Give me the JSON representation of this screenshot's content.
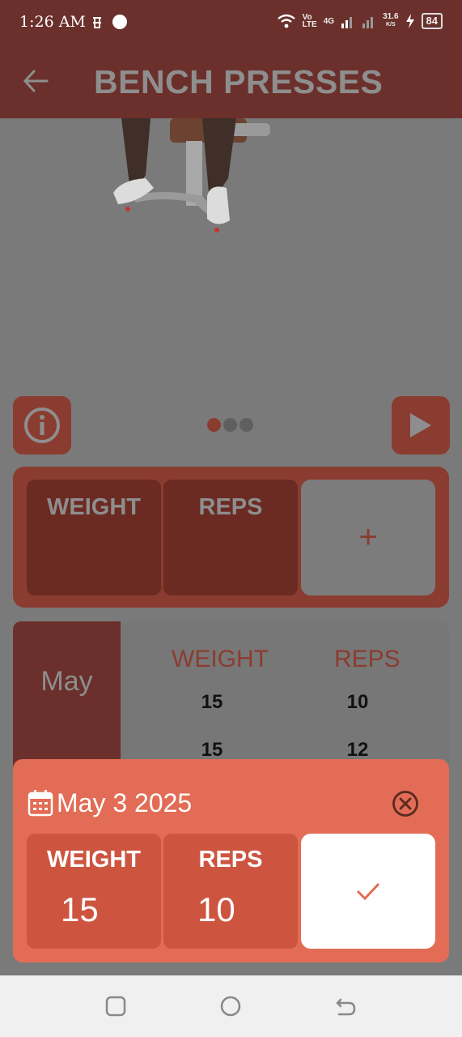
{
  "status_bar": {
    "time": "1:26 AM",
    "network_label": "4G",
    "volte_label": "Vo\nLTE",
    "speed_value": "31.6",
    "speed_unit": "K/S",
    "battery": "84"
  },
  "app_bar": {
    "title": "BENCH PRESSES",
    "back_icon": "arrow-left-icon"
  },
  "controls": {
    "info_icon": "info-icon",
    "play_icon": "play-icon",
    "page_dots": 3,
    "active_dot": 0
  },
  "input_card": {
    "weight_label": "WEIGHT",
    "reps_label": "REPS",
    "add_symbol": "+"
  },
  "history": {
    "month": "May",
    "weight_header": "WEIGHT",
    "reps_header": "REPS",
    "rows": [
      {
        "weight": "15",
        "reps": "10"
      },
      {
        "weight": "15",
        "reps": "12"
      }
    ]
  },
  "sheet": {
    "date": "May 3 2025",
    "weight_label": "WEIGHT",
    "weight_value": "15",
    "reps_label": "REPS",
    "reps_value": "10",
    "confirm_icon": "check-icon",
    "close_icon": "close-circle-icon"
  },
  "colors": {
    "app_bar": "#6b302b",
    "accent": "#8b3c30",
    "sheet": "#e26c55",
    "sheet_cell": "#cd5540"
  },
  "nav_bar": {
    "recents_icon": "square-icon",
    "home_icon": "circle-icon",
    "back_icon": "nav-back-icon"
  }
}
